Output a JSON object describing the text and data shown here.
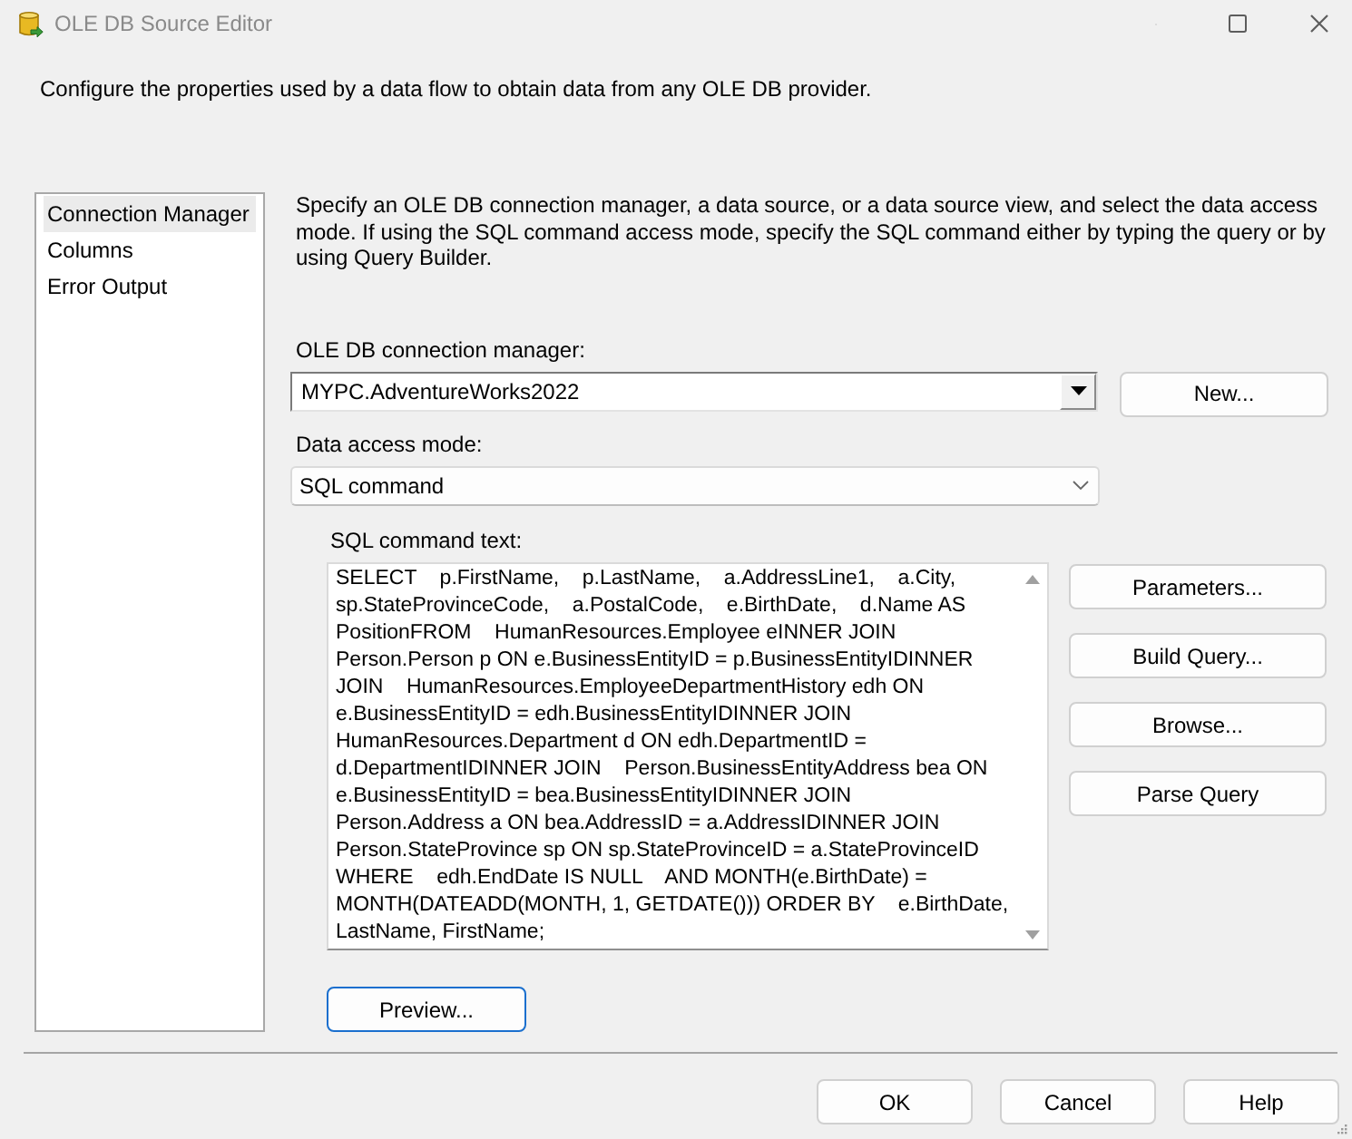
{
  "window": {
    "title": "OLE DB Source Editor",
    "controls": [
      {
        "kind": "minimize",
        "disabled": true
      },
      {
        "kind": "maximize",
        "disabled": false
      },
      {
        "kind": "close",
        "disabled": false
      }
    ]
  },
  "description": "Configure the properties used by a data flow to obtain data from any OLE DB provider.",
  "sidebar": {
    "items": [
      {
        "label": "Connection Manager",
        "selected": true
      },
      {
        "label": "Columns",
        "selected": false
      },
      {
        "label": "Error Output",
        "selected": false
      }
    ]
  },
  "connection_page": {
    "instructions": "Specify an OLE DB connection manager, a data source, or a data source view, and select the data access mode. If using the SQL command access mode, specify the SQL command either by typing the query or by using Query Builder.",
    "connection_manager": {
      "label": "OLE DB connection manager:",
      "value": "MYPC.AdventureWorks2022"
    },
    "new_button": {
      "label": "New...",
      "focused": false
    },
    "access_mode": {
      "label": "Data access mode:",
      "value": "SQL command"
    },
    "sql_command": {
      "label": "SQL command text:",
      "value": "SELECT    p.FirstName,    p.LastName,    a.AddressLine1,    a.City,    sp.StateProvinceCode,    a.PostalCode,    e.BirthDate,    d.Name AS PositionFROM    HumanResources.Employee eINNER JOIN    Person.Person p ON e.BusinessEntityID = p.BusinessEntityIDINNER JOIN    HumanResources.EmployeeDepartmentHistory edh ON e.BusinessEntityID = edh.BusinessEntityIDINNER JOIN    HumanResources.Department d ON edh.DepartmentID = d.DepartmentIDINNER JOIN    Person.BusinessEntityAddress bea ON e.BusinessEntityID = bea.BusinessEntityIDINNER JOIN    Person.Address a ON bea.AddressID = a.AddressIDINNER JOIN    Person.StateProvince sp ON sp.StateProvinceID = a.StateProvinceID WHERE    edh.EndDate IS NULL    AND MONTH(e.BirthDate) = MONTH(DATEADD(MONTH, 1, GETDATE())) ORDER BY    e.BirthDate, LastName, FirstName;"
    },
    "sql_buttons": [
      {
        "label": "Parameters...",
        "focused": false
      },
      {
        "label": "Build Query...",
        "focused": false
      },
      {
        "label": "Browse...",
        "focused": false
      },
      {
        "label": "Parse Query",
        "focused": false
      }
    ],
    "preview_button": {
      "label": "Preview...",
      "focused": true
    }
  },
  "footer_buttons": [
    {
      "label": "OK",
      "focused": false
    },
    {
      "label": "Cancel",
      "focused": false
    },
    {
      "label": "Help",
      "focused": false
    }
  ]
}
